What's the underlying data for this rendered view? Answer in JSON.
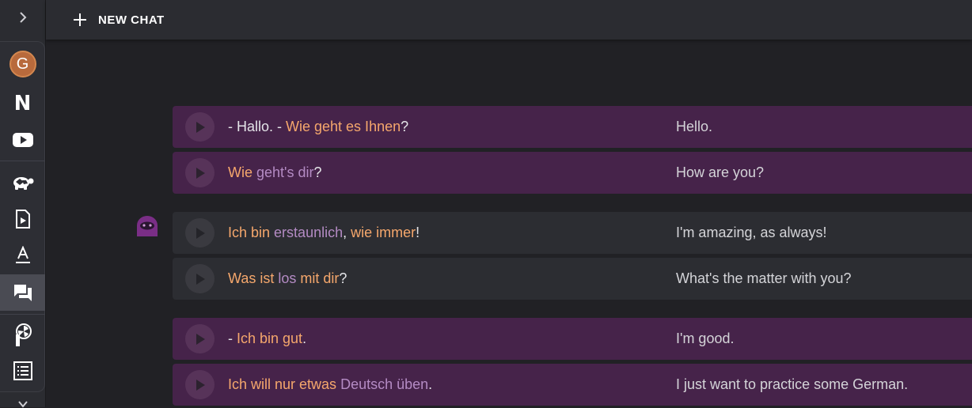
{
  "topbar": {
    "new_chat_label": "NEW CHAT"
  },
  "sidebar": {
    "avatar_letter": "G",
    "n_label": "N",
    "items": [
      {
        "icon": "avatar"
      },
      {
        "icon": "n-icon"
      },
      {
        "icon": "youtube-icon"
      },
      {
        "icon": "turtle-icon"
      },
      {
        "icon": "video-file-icon"
      },
      {
        "icon": "text-format-icon"
      },
      {
        "icon": "chat-icon",
        "active": true
      },
      {
        "icon": "turbine-icon"
      },
      {
        "icon": "list-icon"
      }
    ]
  },
  "messages": [
    {
      "role": "user",
      "segments": [
        {
          "t": "- Hallo. - ",
          "c": "n"
        },
        {
          "t": "Wie geht es Ihnen",
          "c": "k"
        },
        {
          "t": "?",
          "c": "n"
        }
      ],
      "translation": "Hello."
    },
    {
      "role": "user",
      "segments": [
        {
          "t": "Wie",
          "c": "k"
        },
        {
          "t": " geht's dir",
          "c": "u"
        },
        {
          "t": "?",
          "c": "n"
        }
      ],
      "translation": "How are you?"
    },
    {
      "role": "bot",
      "segments": [
        {
          "t": "Ich bin",
          "c": "k"
        },
        {
          "t": " erstaunlich",
          "c": "u"
        },
        {
          "t": ", ",
          "c": "n"
        },
        {
          "t": "wie immer",
          "c": "k"
        },
        {
          "t": "!",
          "c": "n"
        }
      ],
      "translation": "I'm amazing, as always!"
    },
    {
      "role": "bot",
      "segments": [
        {
          "t": "Was ist",
          "c": "k"
        },
        {
          "t": " los",
          "c": "u"
        },
        {
          "t": " mit dir",
          "c": "k"
        },
        {
          "t": "?",
          "c": "n"
        }
      ],
      "translation": "What's the matter with you?"
    },
    {
      "role": "user",
      "segments": [
        {
          "t": "- ",
          "c": "n"
        },
        {
          "t": "Ich bin gut",
          "c": "k"
        },
        {
          "t": ".",
          "c": "n"
        }
      ],
      "translation": "I'm good."
    },
    {
      "role": "user",
      "segments": [
        {
          "t": "Ich will nur etwas",
          "c": "k"
        },
        {
          "t": " Deutsch üben",
          "c": "u"
        },
        {
          "t": ".",
          "c": "n"
        }
      ],
      "translation": "I just want to practice some German."
    }
  ],
  "colors": {
    "known_word": "#f5a76c",
    "unknown_word": "#b48bc4",
    "user_bubble": "#46234a",
    "bot_bubble": "#2c2d32",
    "bot_avatar": "#7a2e86"
  }
}
